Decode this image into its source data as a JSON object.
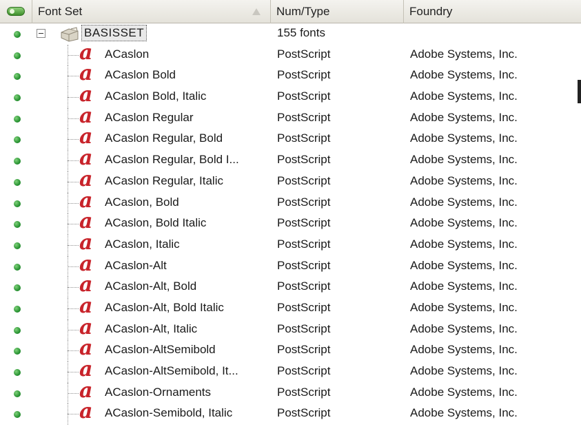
{
  "header": {
    "status_icon": "status-toggle-icon",
    "col_font_set": "Font Set",
    "col_num_type": "Num/Type",
    "col_foundry": "Foundry"
  },
  "set": {
    "name": "BASISSET",
    "count": "155 fonts"
  },
  "colors": {
    "status_dot": "#1e8a2a",
    "font_icon": "#c8242b",
    "header_bg": "#e4e2da"
  },
  "font_icon_glyph": "a",
  "fonts": [
    {
      "name": "ACaslon",
      "type": "PostScript",
      "foundry": "Adobe Systems, Inc."
    },
    {
      "name": "ACaslon Bold",
      "type": "PostScript",
      "foundry": "Adobe Systems, Inc."
    },
    {
      "name": "ACaslon Bold, Italic",
      "type": "PostScript",
      "foundry": "Adobe Systems, Inc."
    },
    {
      "name": "ACaslon Regular",
      "type": "PostScript",
      "foundry": "Adobe Systems, Inc."
    },
    {
      "name": "ACaslon Regular, Bold",
      "type": "PostScript",
      "foundry": "Adobe Systems, Inc."
    },
    {
      "name": "ACaslon Regular, Bold I...",
      "type": "PostScript",
      "foundry": "Adobe Systems, Inc."
    },
    {
      "name": "ACaslon Regular, Italic",
      "type": "PostScript",
      "foundry": "Adobe Systems, Inc."
    },
    {
      "name": "ACaslon, Bold",
      "type": "PostScript",
      "foundry": "Adobe Systems, Inc."
    },
    {
      "name": "ACaslon, Bold Italic",
      "type": "PostScript",
      "foundry": "Adobe Systems, Inc."
    },
    {
      "name": "ACaslon, Italic",
      "type": "PostScript",
      "foundry": "Adobe Systems, Inc."
    },
    {
      "name": "ACaslon-Alt",
      "type": "PostScript",
      "foundry": "Adobe Systems, Inc."
    },
    {
      "name": "ACaslon-Alt, Bold",
      "type": "PostScript",
      "foundry": "Adobe Systems, Inc."
    },
    {
      "name": "ACaslon-Alt, Bold Italic",
      "type": "PostScript",
      "foundry": "Adobe Systems, Inc."
    },
    {
      "name": "ACaslon-Alt, Italic",
      "type": "PostScript",
      "foundry": "Adobe Systems, Inc."
    },
    {
      "name": "ACaslon-AltSemibold",
      "type": "PostScript",
      "foundry": "Adobe Systems, Inc."
    },
    {
      "name": "ACaslon-AltSemibold, It...",
      "type": "PostScript",
      "foundry": "Adobe Systems, Inc."
    },
    {
      "name": "ACaslon-Ornaments",
      "type": "PostScript",
      "foundry": "Adobe Systems, Inc."
    },
    {
      "name": "ACaslon-Semibold, Italic",
      "type": "PostScript",
      "foundry": "Adobe Systems, Inc."
    }
  ]
}
